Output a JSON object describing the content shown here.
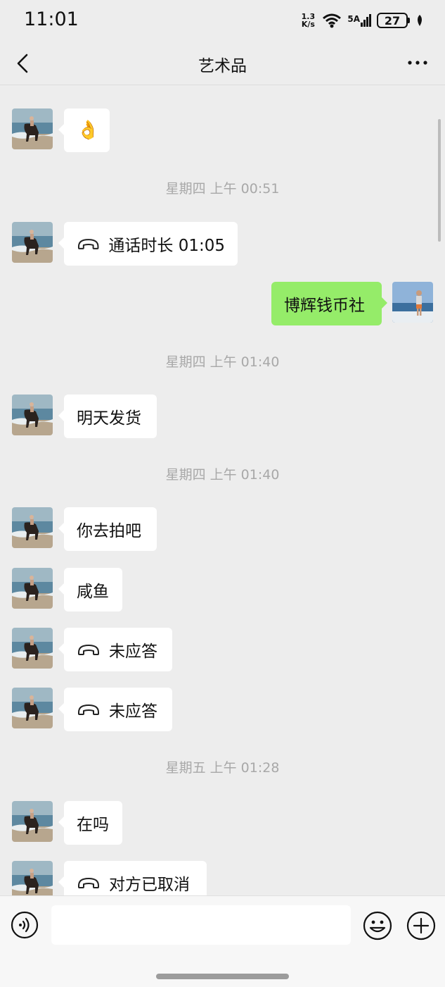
{
  "status_bar": {
    "time": "11:01",
    "net_speed_value": "1.3",
    "net_speed_unit": "K/s",
    "network_label": "5A",
    "battery": "27"
  },
  "header": {
    "title": "艺术品"
  },
  "chat": {
    "timestamps": [
      "星期四 上午 00:51",
      "星期四 上午 01:40",
      "星期四 上午 01:40",
      "星期五 上午 01:28"
    ],
    "messages": [
      {
        "side": "left",
        "kind": "emoji",
        "text": "👌"
      },
      {
        "side": "left",
        "kind": "call",
        "text": "通话时长 01:05"
      },
      {
        "side": "right",
        "kind": "text",
        "text": "博辉钱币社"
      },
      {
        "side": "left",
        "kind": "text",
        "text": "明天发货"
      },
      {
        "side": "left",
        "kind": "text",
        "text": "你去拍吧"
      },
      {
        "side": "left",
        "kind": "text",
        "text": "咸鱼"
      },
      {
        "side": "left",
        "kind": "call",
        "text": "未应答"
      },
      {
        "side": "left",
        "kind": "call",
        "text": "未应答"
      },
      {
        "side": "left",
        "kind": "text",
        "text": "在吗"
      },
      {
        "side": "left",
        "kind": "call",
        "text": "对方已取消"
      }
    ]
  },
  "input_bar": {
    "placeholder": ""
  },
  "icons": {
    "back": "chevron-left-icon",
    "more": "more-dots-icon",
    "voice": "voice-icon",
    "emoji": "emoji-face-icon",
    "plus": "plus-icon",
    "call": "phone-handset-icon"
  },
  "colors": {
    "background": "#ededed",
    "bubble_self": "#95ec69",
    "bubble_other": "#ffffff",
    "timestamp_text": "#a8a8a8"
  }
}
